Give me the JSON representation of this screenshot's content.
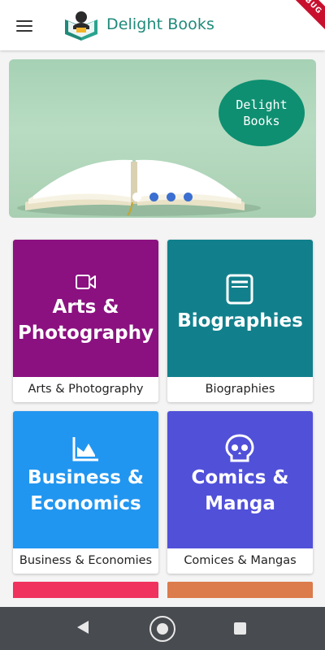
{
  "app": {
    "title": "Delight Books",
    "debug_label": "DEBUG"
  },
  "banner": {
    "badge_line1": "Delight",
    "badge_line2": "Books",
    "slide_count": 4,
    "active_slide": 1
  },
  "categories": [
    {
      "tile_line1": "Arts &",
      "tile_line2": "Photography",
      "caption": "Arts & Photography",
      "color": "#8b1180",
      "icon": "video-camera-icon"
    },
    {
      "tile_line1": "Biographies",
      "tile_line2": "",
      "caption": "Biographies",
      "color": "#11808c",
      "icon": "book-icon"
    },
    {
      "tile_line1": "Business &",
      "tile_line2": "Economics",
      "caption": "Business & Economies",
      "color": "#2196f0",
      "icon": "chart-icon"
    },
    {
      "tile_line1": "Comics &",
      "tile_line2": "Manga",
      "caption": "Comices & Mangas",
      "color": "#5150d9",
      "icon": "skull-icon"
    }
  ],
  "peek_colors": [
    "#f0325e",
    "#dc7b4b"
  ],
  "colors": {
    "brand": "#1f8a7a",
    "banner_badge": "#0e8f71",
    "dot": "#3b6fd1",
    "navbar": "#484b4f"
  }
}
